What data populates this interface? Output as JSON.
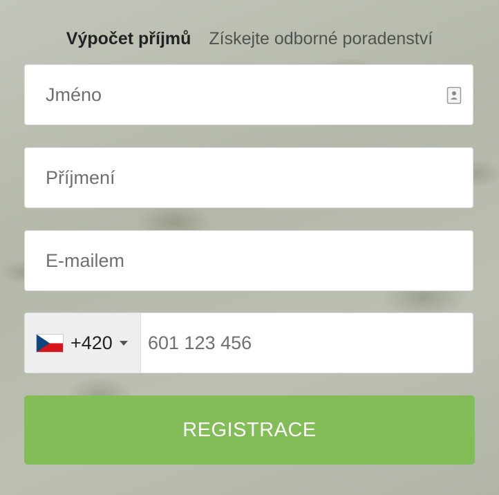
{
  "tabs": [
    {
      "label": "Výpočet příjmů",
      "active": true
    },
    {
      "label": "Získejte odborné poradenství",
      "active": false
    }
  ],
  "form": {
    "first_name": {
      "placeholder": "Jméno",
      "value": ""
    },
    "last_name": {
      "placeholder": "Příjmení",
      "value": ""
    },
    "email": {
      "placeholder": "E-mailem",
      "value": ""
    },
    "phone": {
      "country_flag": "czech-flag-icon",
      "dial_code": "+420",
      "placeholder": "601 123 456",
      "value": ""
    },
    "submit_label": "REGISTRACE"
  },
  "colors": {
    "submit_button": "#83bd58",
    "flag_white": "#ffffff",
    "flag_red": "#d7141a",
    "flag_blue": "#11457e"
  }
}
